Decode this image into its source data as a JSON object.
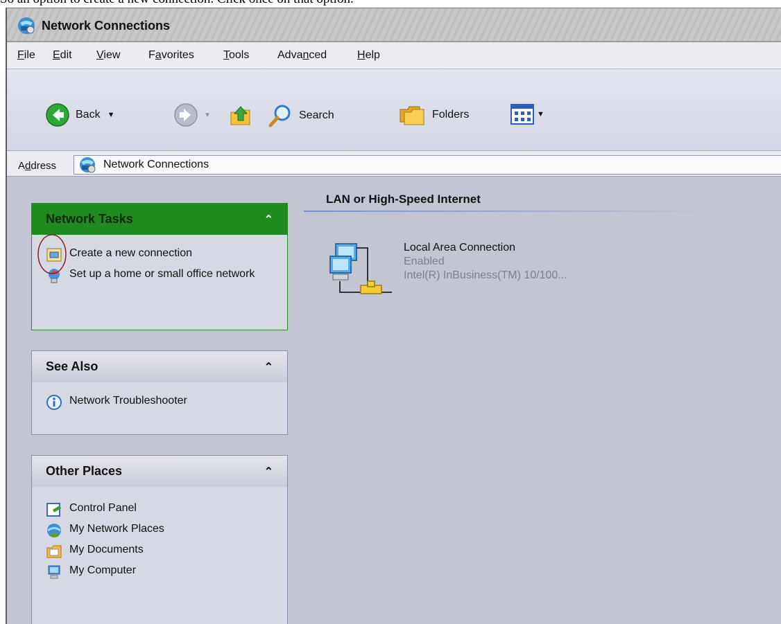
{
  "caption": "So an option to create a new connection. Click once on that option.",
  "window": {
    "title": "Network Connections"
  },
  "menu": [
    {
      "pre": "",
      "key": "F",
      "post": "ile"
    },
    {
      "pre": "",
      "key": "E",
      "post": "dit"
    },
    {
      "pre": "",
      "key": "V",
      "post": "iew"
    },
    {
      "pre": "F",
      "key": "a",
      "post": "vorites"
    },
    {
      "pre": "",
      "key": "T",
      "post": "ools"
    },
    {
      "pre": "Adva",
      "key": "n",
      "post": "ced"
    },
    {
      "pre": "",
      "key": "H",
      "post": "elp"
    }
  ],
  "toolbar": {
    "back": "Back",
    "search": "Search",
    "folders": "Folders"
  },
  "address": {
    "label_pre": "A",
    "label_key": "d",
    "label_post": "dress",
    "value": "Network Connections"
  },
  "panels": {
    "network_tasks": {
      "title": "Network Tasks",
      "items": [
        "Create a new connection",
        "Set up a home or small office network"
      ]
    },
    "see_also": {
      "title": "See Also",
      "items": [
        "Network Troubleshooter"
      ]
    },
    "other_places": {
      "title": "Other Places",
      "items": [
        "Control Panel",
        "My Network Places",
        "My Documents",
        "My Computer"
      ]
    }
  },
  "main": {
    "section": "LAN or High-Speed Internet",
    "connection": {
      "name": "Local Area Connection",
      "status": "Enabled",
      "device": "Intel(R) InBusiness(TM) 10/100..."
    }
  },
  "colors": {
    "tasks_header": "#1f8a1f",
    "content_bg": "#c3c5d3"
  }
}
